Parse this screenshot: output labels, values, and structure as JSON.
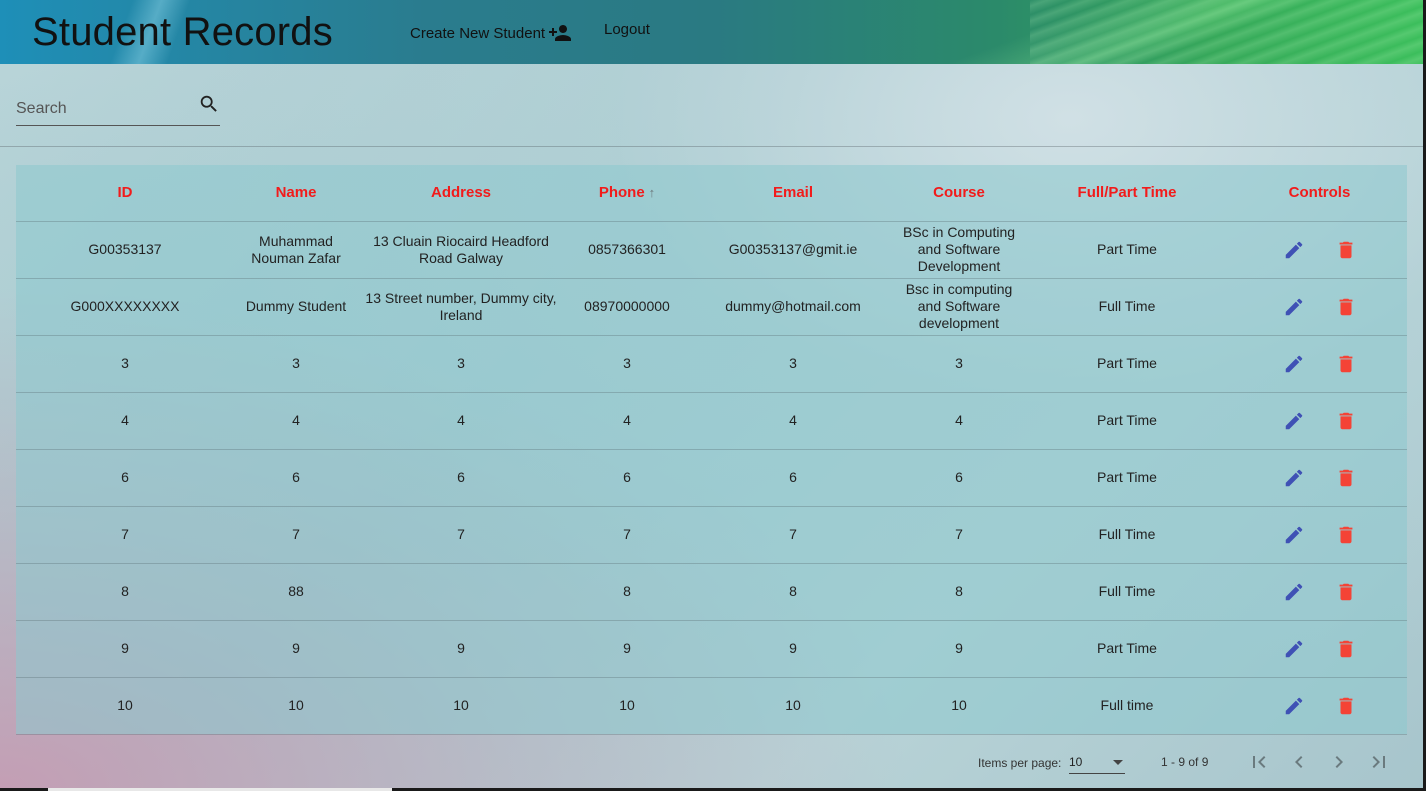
{
  "header": {
    "title": "Student Records",
    "create_label": "Create New Student",
    "logout_label": "Logout"
  },
  "search": {
    "placeholder": "Search",
    "value": ""
  },
  "table": {
    "columns": [
      "ID",
      "Name",
      "Address",
      "Phone",
      "Email",
      "Course",
      "Full/Part Time",
      "Controls"
    ],
    "sorted_column": "Phone",
    "rows": [
      {
        "id": "G00353137",
        "name": "Muhammad Nouman Zafar",
        "address": "13 Cluain Riocaird Headford Road Galway",
        "phone": "0857366301",
        "email": "G00353137@gmit.ie",
        "course": "BSc in Computing and Software Development",
        "time": "Part Time"
      },
      {
        "id": "G000XXXXXXXX",
        "name": "Dummy Student",
        "address": "13 Street number, Dummy city, Ireland",
        "phone": "08970000000",
        "email": "dummy@hotmail.com",
        "course": "Bsc in computing and Software development",
        "time": "Full Time"
      },
      {
        "id": "3",
        "name": "3",
        "address": "3",
        "phone": "3",
        "email": "3",
        "course": "3",
        "time": "Part Time"
      },
      {
        "id": "4",
        "name": "4",
        "address": "4",
        "phone": "4",
        "email": "4",
        "course": "4",
        "time": "Part Time"
      },
      {
        "id": "6",
        "name": "6",
        "address": "6",
        "phone": "6",
        "email": "6",
        "course": "6",
        "time": "Part Time"
      },
      {
        "id": "7",
        "name": "7",
        "address": "7",
        "phone": "7",
        "email": "7",
        "course": "7",
        "time": "Full Time"
      },
      {
        "id": "8",
        "name": "88",
        "address": "",
        "phone": "8",
        "email": "8",
        "course": "8",
        "time": "Full Time"
      },
      {
        "id": "9",
        "name": "9",
        "address": "9",
        "phone": "9",
        "email": "9",
        "course": "9",
        "time": "Part Time"
      },
      {
        "id": "10",
        "name": "10",
        "address": "10",
        "phone": "10",
        "email": "10",
        "course": "10",
        "time": "Full time"
      }
    ]
  },
  "paginator": {
    "items_per_page_label": "Items per page:",
    "items_per_page": "10",
    "range_label": "1 - 9 of 9"
  },
  "icons": {
    "edit": "pencil-icon",
    "delete": "trash-icon",
    "search": "magnifier-icon",
    "add_user": "person-add-icon"
  },
  "colors": {
    "header_text": "#f21b1b",
    "edit_icon": "#3f51b5",
    "delete_icon": "#f44336"
  }
}
